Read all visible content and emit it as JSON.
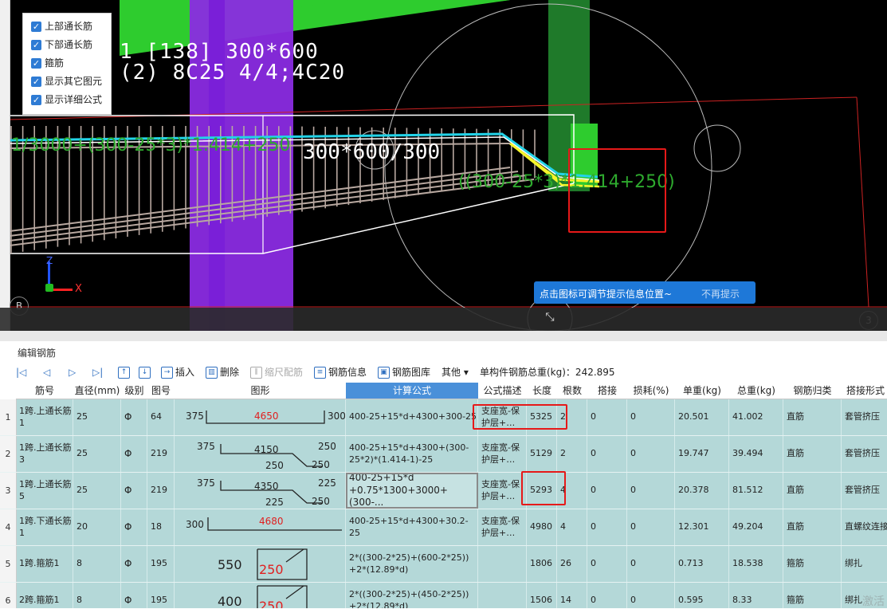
{
  "legend": {
    "items": [
      {
        "label": "上部通长筋",
        "checked": true
      },
      {
        "label": "下部通长筋",
        "checked": true
      },
      {
        "label": "箍筋",
        "checked": true
      },
      {
        "label": "显示其它图元",
        "checked": true
      },
      {
        "label": "显示详细公式",
        "checked": true
      }
    ]
  },
  "viewport": {
    "beam_label_1": "1 [138] 300*600",
    "beam_label_2": "(2) 8C25 4/4;4C20",
    "formula_green_1": "1/3000+(300-25*3)*1.414+250",
    "formula_white": "300*600/300",
    "formula_green_2": "((300-25*3)*1.414+250)",
    "axis_z": "Z",
    "axis_x": "X",
    "marker_b": "B",
    "marker_3": "3",
    "tip_text": "点击图标可调节提示信息位置~",
    "tip_dismiss": "不再提示"
  },
  "panel": {
    "title": "编辑钢筋",
    "toolbar": {
      "insert": "插入",
      "delete": "删除",
      "scale": "缩尺配筋",
      "info": "钢筋信息",
      "library": "钢筋图库",
      "other": "其他",
      "total_label": "单构件钢筋总重(kg)：242.895"
    },
    "headers": [
      "筋号",
      "直径(mm)",
      "级别",
      "图号",
      "图形",
      "计算公式",
      "公式描述",
      "长度",
      "根数",
      "搭接",
      "损耗(%)",
      "单重(kg)",
      "总重(kg)",
      "钢筋归类",
      "搭接形式"
    ],
    "rows": [
      {
        "no": "1",
        "name": "1跨.上通长筋1",
        "dia": "25",
        "grade": "Φ",
        "fig": "64",
        "formula": "400-25+15*d+4300+300-25",
        "desc": "支座宽-保护层+…",
        "len": "5325",
        "count": "2",
        "lap": "0",
        "loss": "0",
        "unit_w": "20.501",
        "total_w": "41.002",
        "cat": "直筋",
        "lap_type": "套管挤压",
        "shape": {
          "a": "375",
          "b": "4650",
          "c": "300"
        }
      },
      {
        "no": "2",
        "name": "1跨.上通长筋3",
        "dia": "25",
        "grade": "Φ",
        "fig": "219",
        "formula": "400-25+15*d+4300+(300-25*2)*(1.414-1)-25",
        "desc": "支座宽-保护层+…",
        "len": "5129",
        "count": "2",
        "lap": "0",
        "loss": "0",
        "unit_w": "19.747",
        "total_w": "39.494",
        "cat": "直筋",
        "lap_type": "套管挤压",
        "shape": {
          "a": "375",
          "b": "4150",
          "c": "250",
          "d": "250",
          "e": "250"
        }
      },
      {
        "no": "3",
        "name": "1跨.上通长筋5",
        "dia": "25",
        "grade": "Φ",
        "fig": "219",
        "formula": "400-25+15*d +0.75*1300+3000+(300-...",
        "desc": "支座宽-保护层+…",
        "len": "5293",
        "count": "4",
        "lap": "0",
        "loss": "0",
        "unit_w": "20.378",
        "total_w": "81.512",
        "cat": "直筋",
        "lap_type": "套管挤压",
        "shape": {
          "a": "375",
          "b": "4350",
          "c": "225",
          "d": "225",
          "e": "250"
        }
      },
      {
        "no": "4",
        "name": "1跨.下通长筋1",
        "dia": "20",
        "grade": "Φ",
        "fig": "18",
        "formula": "400-25+15*d+4300+30.2-25",
        "desc": "支座宽-保护层+…",
        "len": "4980",
        "count": "4",
        "lap": "0",
        "loss": "0",
        "unit_w": "12.301",
        "total_w": "49.204",
        "cat": "直筋",
        "lap_type": "直螺纹连接",
        "shape": {
          "a": "300",
          "b": "4680"
        }
      },
      {
        "no": "5",
        "name": "1跨.箍筋1",
        "dia": "8",
        "grade": "Φ",
        "fig": "195",
        "formula": "2*((300-2*25)+(600-2*25)) +2*(12.89*d)",
        "desc": "",
        "len": "1806",
        "count": "26",
        "lap": "0",
        "loss": "0",
        "unit_w": "0.713",
        "total_w": "18.538",
        "cat": "箍筋",
        "lap_type": "绑扎",
        "shape": {
          "a": "550",
          "b": "250"
        }
      },
      {
        "no": "6",
        "name": "2跨.箍筋1",
        "dia": "8",
        "grade": "Φ",
        "fig": "195",
        "formula": "2*((300-2*25)+(450-2*25)) +2*(12.89*d)",
        "desc": "",
        "len": "1506",
        "count": "14",
        "lap": "0",
        "loss": "0",
        "unit_w": "0.595",
        "total_w": "8.33",
        "cat": "箍筋",
        "lap_type": "绑扎",
        "shape": {
          "a": "400",
          "b": "250"
        }
      }
    ],
    "watermark": "激活"
  }
}
